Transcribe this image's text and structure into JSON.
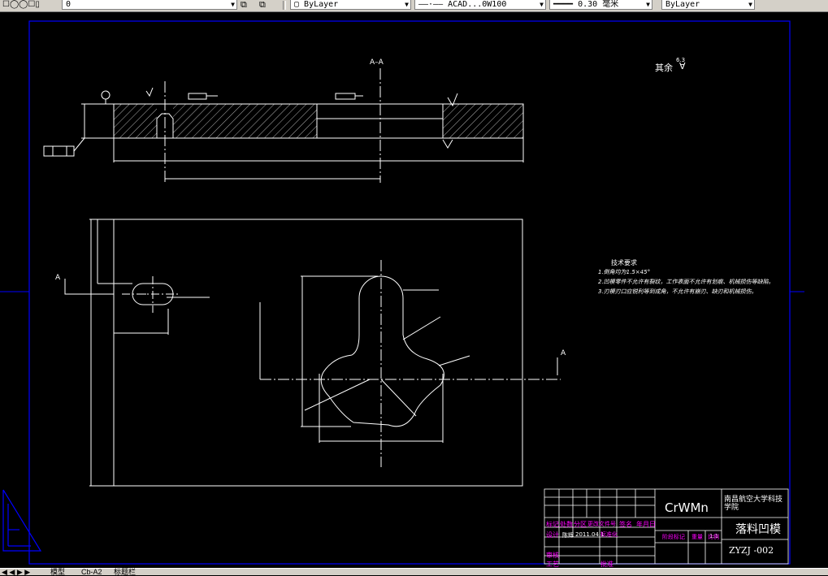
{
  "toolbar": {
    "layer_value": "0",
    "color_combo": "ByLayer",
    "linetype_combo": "ACAD...0W100",
    "lineweight_combo": "0.30 毫米",
    "plotstyle_combo": "ByLayer"
  },
  "drawing": {
    "section_label_top": "A–A",
    "section_marker_left": "A",
    "section_marker_right": "A",
    "surface_finish_note": "其余",
    "surface_finish_value": "6.3",
    "technical_requirements": {
      "title": "技术要求",
      "items": [
        "1.倒角均为1.5×45°",
        "2.凹模零件不允许有裂纹，工作表面不允许有划痕、机械损伤等缺陷。",
        "3.刃模刃口应锐利等到成角，不允许有崩刃、缺刃和机械损伤。"
      ]
    }
  },
  "title_block": {
    "material": "CrWMn",
    "school": "南昌航空大学科技学院",
    "part_name": "落料凹模",
    "drawing_number": "ZYZJ -002",
    "scale_value": "1:1",
    "header_labels": [
      "标记",
      "处数",
      "分区",
      "更改文件号",
      "签名",
      "年月日"
    ],
    "row_labels": [
      "设计",
      "审核",
      "工艺"
    ],
    "stage_label": "阶段标记",
    "weight_label": "重量",
    "scale_label": "比例",
    "approve_label": "批准",
    "std_label": "标准化",
    "designer_name": "陈辉",
    "design_date": "2011.04.1"
  },
  "status_tabs": [
    "模型",
    "Cb-A2",
    "标题栏"
  ],
  "colors": {
    "frame": "#0000ff",
    "geometry": "#ffffff",
    "title_labels": "#ff00ff",
    "background": "#000000"
  }
}
